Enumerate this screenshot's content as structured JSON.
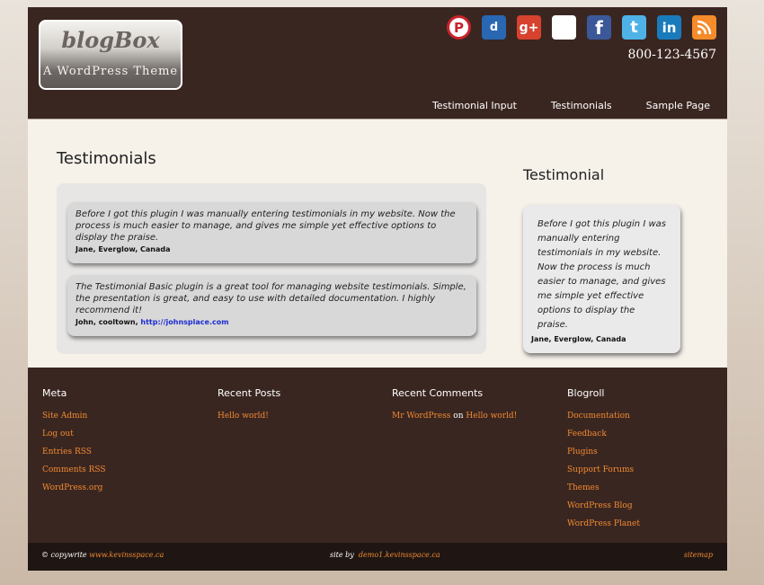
{
  "logo": {
    "title": "blogBox",
    "subtitle": "A WordPress Theme"
  },
  "social": [
    "pinterest-icon",
    "delicious-icon",
    "google-plus-icon",
    "delicious-blocks-icon",
    "facebook-icon",
    "twitter-icon",
    "linkedin-icon",
    "rss-icon"
  ],
  "phone": "800-123-4567",
  "nav": [
    "Testimonial Input",
    "Testimonials",
    "Sample Page"
  ],
  "page": {
    "title": "Testimonials"
  },
  "testimonials": [
    {
      "text": "Before I got this plugin I was manually entering testimonials in my website. Now the process is much easier to manage, and gives me simple yet effective options to display the praise.",
      "author": "Jane, Everglow, Canada"
    },
    {
      "text": "The Testimonial Basic plugin is a great tool for managing website testimonials. Simple, the presentation is great, and easy to use with detailed documentation. I highly recommend it!",
      "author": "John, cooltown, ",
      "link": "http://johnsplace.com"
    }
  ],
  "sidebar": {
    "title": "Testimonial",
    "text": "Before I got this plugin I was manually entering testimonials in my website. Now the process is much easier to manage, and gives me simple yet effective options to display the praise.",
    "author": "Jane, Everglow, Canada"
  },
  "footer": {
    "meta": {
      "title": "Meta",
      "links": [
        "Site Admin",
        "Log out",
        "Entries RSS",
        "Comments RSS",
        "WordPress.org"
      ]
    },
    "recent_posts": {
      "title": "Recent Posts",
      "links": [
        "Hello world!"
      ]
    },
    "recent_comments": {
      "title": "Recent Comments",
      "author": "Mr WordPress",
      "on": "on",
      "post": "Hello world!"
    },
    "blogroll": {
      "title": "Blogroll",
      "links": [
        "Documentation",
        "Feedback",
        "Plugins",
        "Support Forums",
        "Themes",
        "WordPress Blog",
        "WordPress Planet"
      ]
    }
  },
  "bottom": {
    "copyright": "© copywrite",
    "copyright_link": "www.kevinsspace.ca",
    "site_by": "site by",
    "site_by_link": "demo1.kevinsspace.ca",
    "sitemap": "sitemap"
  },
  "colors": {
    "header_bg": "#3a2621",
    "content_bg": "#f6f1e9",
    "link": "#f08a30"
  }
}
